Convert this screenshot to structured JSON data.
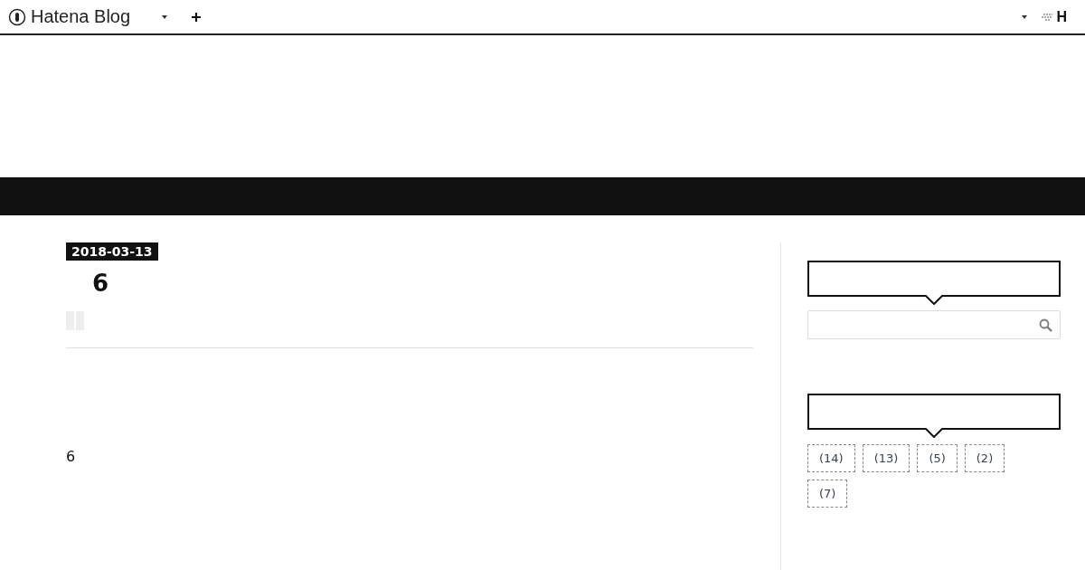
{
  "global_header": {
    "logo": "Hatena Blog",
    "right_logo": "H"
  },
  "entry": {
    "date": "2018-03-13",
    "title": "6",
    "body": "6"
  },
  "sidebar": {
    "categories": [
      {
        "label": "(14)"
      },
      {
        "label": "(13)"
      },
      {
        "label": "(5)"
      },
      {
        "label": "(2)"
      },
      {
        "label": "(7)"
      }
    ]
  }
}
